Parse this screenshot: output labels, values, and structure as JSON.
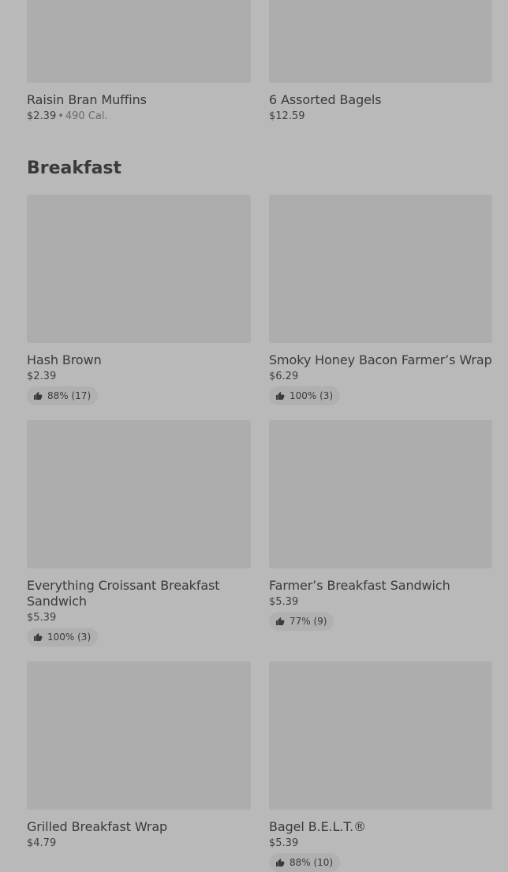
{
  "top_row": [
    {
      "name": "Raisin Bran Muffins",
      "price": "$2.39",
      "calories": "490 Cal."
    },
    {
      "name": "6 Assorted Bagels",
      "price": "$12.59"
    }
  ],
  "section": {
    "title": "Breakfast",
    "items": [
      {
        "name": "Hash Brown",
        "price": "$2.39",
        "rating": "88% (17)"
      },
      {
        "name": "Smoky Honey Bacon Farmer’s Wrap",
        "price": "$6.29",
        "rating": "100% (3)"
      },
      {
        "name": "Everything Croissant Breakfast Sandwich",
        "price": "$5.39",
        "rating": "100% (3)"
      },
      {
        "name": "Farmer’s Breakfast Sandwich",
        "price": "$5.39",
        "rating": "77% (9)"
      },
      {
        "name": "Grilled Breakfast Wrap",
        "price": "$4.79"
      },
      {
        "name": "Bagel B.E.L.T.®",
        "price": "$5.39",
        "rating": "88% (10)"
      }
    ]
  },
  "icons": {
    "rating": "thumbs-up-icon"
  },
  "colors": {
    "background": "#b9b9b9",
    "image_placeholder": "#adadad",
    "rating_pill": "#b0b0b0"
  }
}
